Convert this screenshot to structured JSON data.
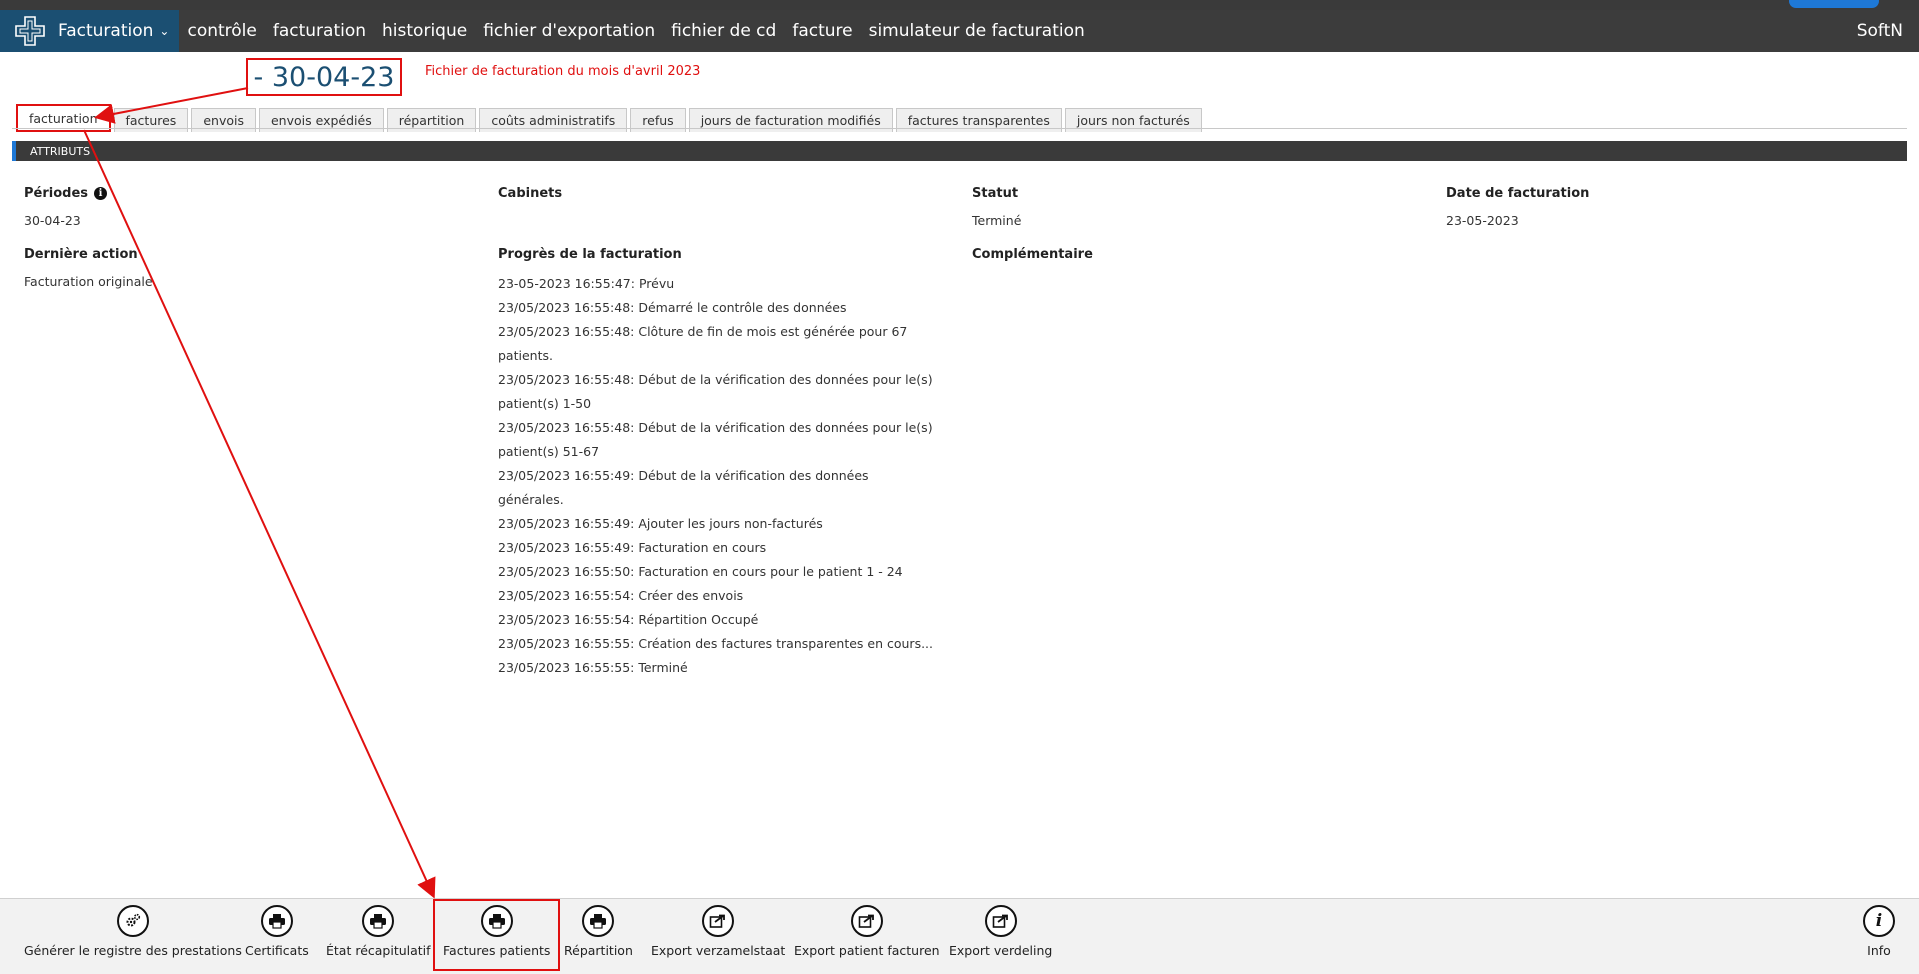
{
  "navbar": {
    "brand_label": "Facturation",
    "items": [
      "contrôle",
      "facturation",
      "historique",
      "fichier d'exportation",
      "fichier de cd",
      "facture",
      "simulateur de facturation"
    ],
    "user": "SoftN"
  },
  "header": {
    "date_title": "- 30-04-23",
    "note": "Fichier de facturation du mois d'avril 2023"
  },
  "tabs": [
    "facturation",
    "factures",
    "envois",
    "envois expédiés",
    "répartition",
    "coûts administratifs",
    "refus",
    "jours de facturation modifiés",
    "factures transparentes",
    "jours non facturés"
  ],
  "section_title": "ATTRIBUTS",
  "attributes": {
    "periodes_label": "Périodes",
    "periodes_value": "30-04-23",
    "cabinets_label": "Cabinets",
    "statut_label": "Statut",
    "statut_value": "Terminé",
    "date_label": "Date de facturation",
    "date_value": "23-05-2023",
    "derniere_label": "Dernière action",
    "derniere_value": "Facturation originale",
    "progres_label": "Progrès de la facturation",
    "complementaire_label": "Complémentaire"
  },
  "progress": [
    "23-05-2023 16:55:47: Prévu",
    "23/05/2023 16:55:48: Démarré le contrôle des données",
    "23/05/2023 16:55:48: Clôture de fin de mois est générée pour  67 patients.",
    "23/05/2023 16:55:48: Début de la vérification des données pour le(s)",
    "patient(s)  1-50",
    "23/05/2023 16:55:48: Début de la vérification des données pour le(s)",
    "patient(s)  51-67",
    "23/05/2023 16:55:49: Début de la vérification des données générales.",
    "23/05/2023 16:55:49: Ajouter les jours non-facturés",
    "23/05/2023 16:55:49: Facturation en cours",
    "23/05/2023 16:55:50: Facturation en cours pour le patient 1 - 24",
    "23/05/2023 16:55:54: Créer des envois",
    "23/05/2023 16:55:54: Répartition Occupé",
    "23/05/2023 16:55:55: Création des factures transparentes en cours...",
    "23/05/2023 16:55:55: Terminé"
  ],
  "footer": {
    "buttons": [
      {
        "label": "Générer le registre des prestations",
        "icon": "gears-icon"
      },
      {
        "label": "Certificats",
        "icon": "print-icon"
      },
      {
        "label": "État récapitulatif",
        "icon": "print-icon"
      },
      {
        "label": "Factures patients",
        "icon": "print-icon"
      },
      {
        "label": "Répartition",
        "icon": "print-icon"
      },
      {
        "label": "Export verzamelstaat",
        "icon": "export-icon"
      },
      {
        "label": "Export patient facturen",
        "icon": "export-icon"
      },
      {
        "label": "Export verdeling",
        "icon": "export-icon"
      }
    ],
    "info_label": "Info",
    "info_icon": "info-icon"
  },
  "colors": {
    "navbar": "#3c3c3c",
    "brand": "#1b4f72",
    "annotation": "#e01010"
  }
}
